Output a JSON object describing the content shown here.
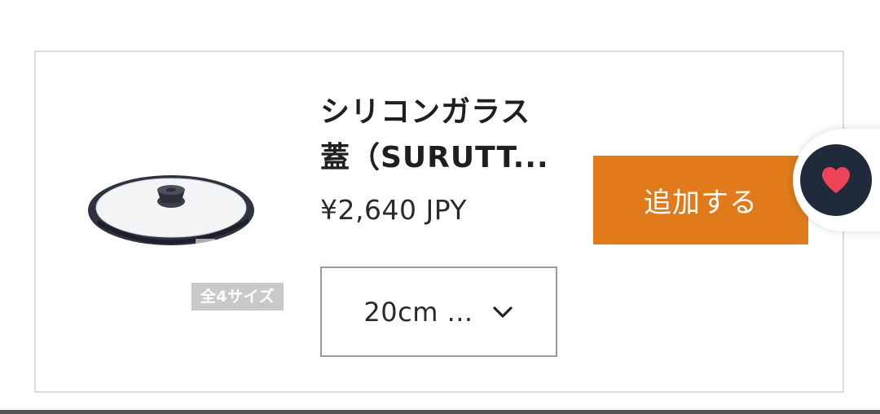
{
  "product": {
    "title_line1": "シリコンガラス",
    "title_line2": "蓋（SURUTT...",
    "price": "¥2,640 JPY",
    "size_badge": "全4サイズ",
    "image_icon": "pot-lid-icon"
  },
  "variant": {
    "selected": "20cm ..."
  },
  "actions": {
    "add_label": "追加する",
    "favorite_icon": "heart-icon"
  },
  "colors": {
    "accent": "#e17a1a",
    "favorite_bg": "#1f2a3a",
    "heart": "#ee4357"
  }
}
